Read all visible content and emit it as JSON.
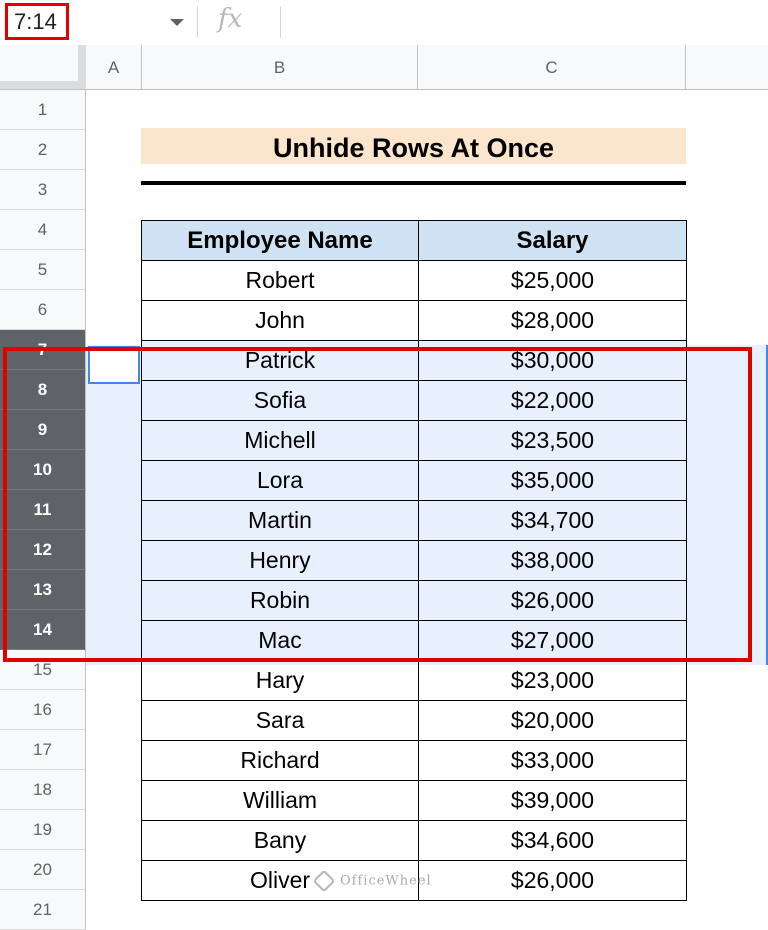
{
  "formula_bar": {
    "name_box": "7:14",
    "fx_label": "fx",
    "formula": ""
  },
  "columns": [
    "A",
    "B",
    "C"
  ],
  "rows": [
    "1",
    "2",
    "3",
    "4",
    "5",
    "6",
    "7",
    "8",
    "9",
    "10",
    "11",
    "12",
    "13",
    "14",
    "15",
    "16",
    "17",
    "18",
    "19",
    "20",
    "21"
  ],
  "selected_rows": [
    "7",
    "8",
    "9",
    "10",
    "11",
    "12",
    "13",
    "14"
  ],
  "sheet": {
    "title": "Unhide Rows At Once",
    "headers": {
      "name": "Employee Name",
      "salary": "Salary"
    },
    "records": [
      {
        "name": "Robert",
        "salary": "$25,000"
      },
      {
        "name": "John",
        "salary": "$28,000"
      },
      {
        "name": "Patrick",
        "salary": "$30,000"
      },
      {
        "name": "Sofia",
        "salary": "$22,000"
      },
      {
        "name": "Michell",
        "salary": "$23,500"
      },
      {
        "name": "Lora",
        "salary": "$35,000"
      },
      {
        "name": "Martin",
        "salary": "$34,700"
      },
      {
        "name": "Henry",
        "salary": "$38,000"
      },
      {
        "name": "Robin",
        "salary": "$26,000"
      },
      {
        "name": "Mac",
        "salary": "$27,000"
      },
      {
        "name": "Hary",
        "salary": "$23,000"
      },
      {
        "name": "Sara",
        "salary": "$20,000"
      },
      {
        "name": "Richard",
        "salary": "$33,000"
      },
      {
        "name": "William",
        "salary": "$39,000"
      },
      {
        "name": "Bany",
        "salary": "$34,600"
      },
      {
        "name": "Oliver",
        "salary": "$26,000"
      }
    ]
  },
  "watermark": "OfficeWheel",
  "colors": {
    "selection_highlight": "#e00000",
    "selected_band": "#e8f0fe",
    "selected_row_header": "#5f6368",
    "title_fill": "#fce5cd",
    "table_header_fill": "#cfe2f3",
    "accent_blue": "#4285f4"
  }
}
